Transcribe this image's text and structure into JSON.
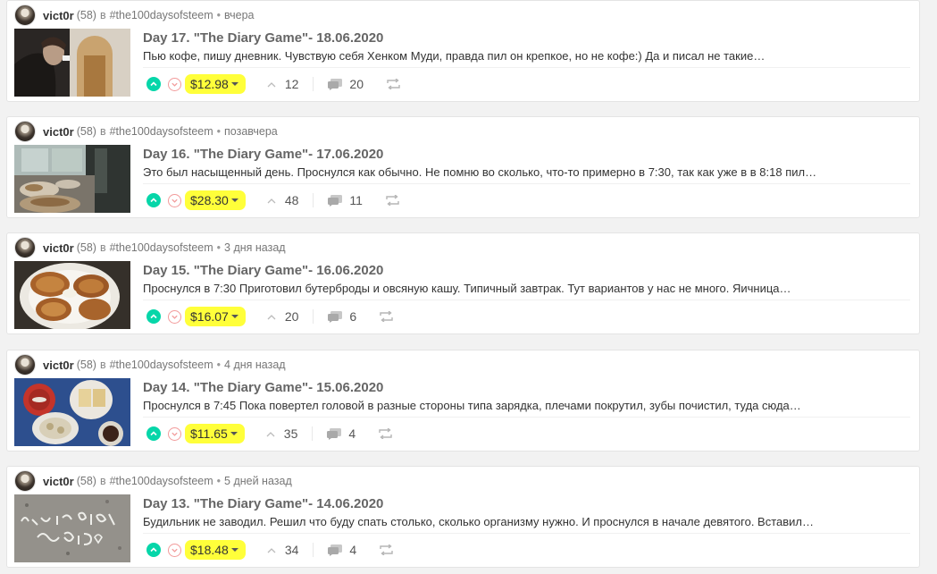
{
  "labels": {
    "in": "в"
  },
  "colors": {
    "upvote": "#06d6a9",
    "downvote_border": "#f29b9b",
    "payout_highlight": "#ffff3a",
    "title": "#666666"
  },
  "icons": {
    "upvote": "chevron-up-circle-icon",
    "downvote": "chevron-down-circle-icon",
    "payout_menu": "caret-down-icon",
    "votes": "caret-up-icon",
    "replies": "comments-icon",
    "reblog": "reblog-icon"
  },
  "posts": [
    {
      "author": "vict0r",
      "reputation": "(58)",
      "community": "#the100daysofsteem",
      "time": "вчера",
      "title": "Day 17. \"The Diary Game\"- 18.06.2020",
      "excerpt": "Пью кофе, пишу дневник. Чувствую себя Хенком Муди, правда пил он крепкое, но не кофе:) Да и писал не такие…",
      "payout": "$12.98",
      "votes": "12",
      "replies": "20",
      "thumbnail": "man-drinking-coffee"
    },
    {
      "author": "vict0r",
      "reputation": "(58)",
      "community": "#the100daysofsteem",
      "time": "позавчера",
      "title": "Day 16. \"The Diary Game\"- 17.06.2020",
      "excerpt": "Это был насыщенный день. Проснулся как обычно. Не помню во сколько, что-то примерно в 7:30, так как уже в в 8:18 пил…",
      "payout": "$28.30",
      "votes": "48",
      "replies": "11",
      "thumbnail": "table-with-food-by-window"
    },
    {
      "author": "vict0r",
      "reputation": "(58)",
      "community": "#the100daysofsteem",
      "time": "3 дня назад",
      "title": "Day 15. \"The Diary Game\"- 16.06.2020",
      "excerpt": "Проснулся в 7:30 Приготовил бутерброды и овсяную кашу. Типичный завтрак. Тут вариантов у нас не много. Яичница…",
      "payout": "$16.07",
      "votes": "20",
      "replies": "6",
      "thumbnail": "potato-pancakes-on-plate"
    },
    {
      "author": "vict0r",
      "reputation": "(58)",
      "community": "#the100daysofsteem",
      "time": "4 дня назад",
      "title": "Day 14. \"The Diary Game\"- 15.06.2020",
      "excerpt": "Проснулся в 7:45 Пока повертел головой в разные стороны типа зарядка, плечами покрутил, зубы почистил, туда сюда…",
      "payout": "$11.65",
      "votes": "35",
      "replies": "4",
      "thumbnail": "breakfast-on-blue-table"
    },
    {
      "author": "vict0r",
      "reputation": "(58)",
      "community": "#the100daysofsteem",
      "time": "5 дней назад",
      "title": "Day 13. \"The Diary Game\"- 14.06.2020",
      "excerpt": "Будильник не заводил. Решил что буду спать столько, сколько организму нужно. И проснулся в начале девятого. Вставил…",
      "payout": "$18.48",
      "votes": "34",
      "replies": "4",
      "thumbnail": "graffiti-on-asphalt"
    }
  ]
}
